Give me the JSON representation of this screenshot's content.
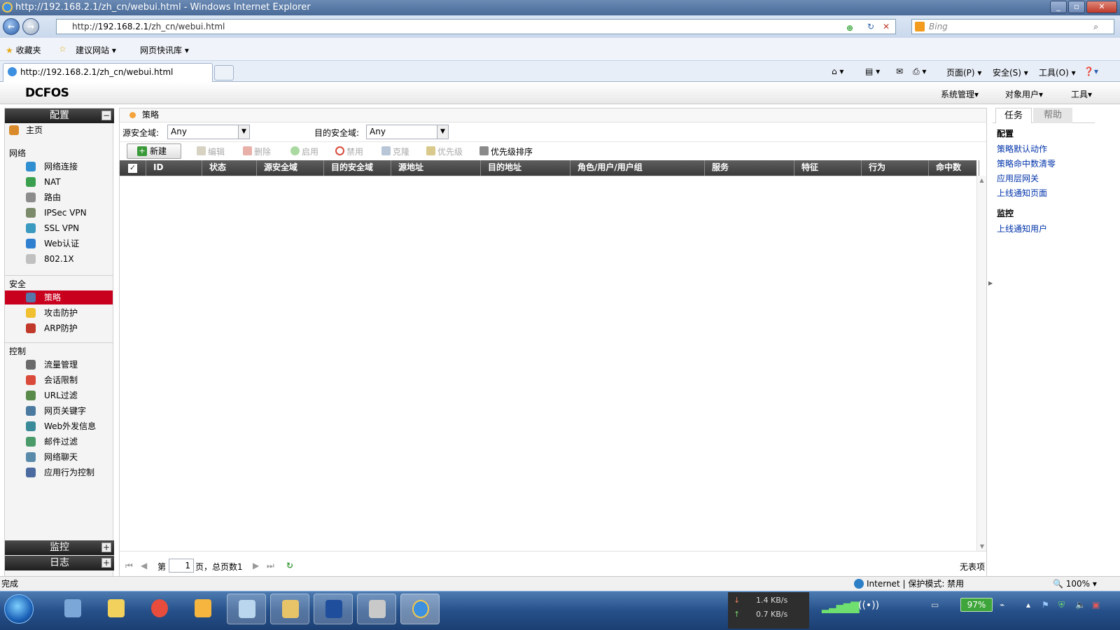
{
  "browser": {
    "title": "http://192.168.2.1/zh_cn/webui.html - Windows Internet Explorer",
    "address_prefix": "http://",
    "address_host": "192.168.2.1",
    "address_path": "/zh_cn/webui.html",
    "search_placeholder": "Bing",
    "favorites": "收藏夹",
    "suggested_sites": "建议网站",
    "web_slice": "网页快讯库",
    "tab_title": "http://192.168.2.1/zh_cn/webui.html",
    "cmd_page": "页面(P)",
    "cmd_safety": "安全(S)",
    "cmd_tools": "工具(O)"
  },
  "app": {
    "logo": "DCFOS",
    "menu_system": "系统管理",
    "menu_objects": "对象用户",
    "menu_tools": "工具"
  },
  "sidebar": {
    "config_header": "配置",
    "home": "主页",
    "network_section": "网络",
    "network_items": [
      "网络连接",
      "NAT",
      "路由",
      "IPSec VPN",
      "SSL VPN",
      "Web认证",
      "802.1X"
    ],
    "security_section": "安全",
    "security_items": [
      "策略",
      "攻击防护",
      "ARP防护"
    ],
    "control_section": "控制",
    "control_items": [
      "流量管理",
      "会话限制",
      "URL过滤",
      "网页关键字",
      "Web外发信息",
      "邮件过滤",
      "网络聊天",
      "应用行为控制"
    ],
    "monitor_header": "监控",
    "log_header": "日志",
    "expand_symbol": "+",
    "collapse_symbol": "−"
  },
  "main": {
    "breadcrumb": "策略",
    "src_zone_label": "源安全域:",
    "src_zone_value": "Any",
    "dst_zone_label": "目的安全域:",
    "dst_zone_value": "Any",
    "toolbar": {
      "new": "新建",
      "edit": "编辑",
      "delete": "删除",
      "enable": "启用",
      "disable": "禁用",
      "clone": "克隆",
      "priority": "优先级",
      "priority_sort": "优先级排序"
    },
    "columns": [
      "ID",
      "状态",
      "源安全域",
      "目的安全域",
      "源地址",
      "目的地址",
      "角色/用户/用户组",
      "服务",
      "特征",
      "行为",
      "命中数"
    ],
    "pager": {
      "page_prefix": "第",
      "page_value": "1",
      "page_suffix": "页，总页数1",
      "empty_text": "无表项"
    }
  },
  "right_panel": {
    "tab_tasks": "任务",
    "tab_help": "帮助",
    "config_heading": "配置",
    "config_links": [
      "策略默认动作",
      "策略命中数清零",
      "应用层网关",
      "上线通知页面"
    ],
    "monitor_heading": "监控",
    "monitor_links": [
      "上线通知用户"
    ]
  },
  "statusbar": {
    "left": "完成",
    "zone": "Internet | 保护模式: 禁用",
    "zoom": "100%"
  },
  "taskbar": {
    "download": "1.4 KB/s",
    "upload": "0.7 KB/s",
    "battery": "97%"
  }
}
